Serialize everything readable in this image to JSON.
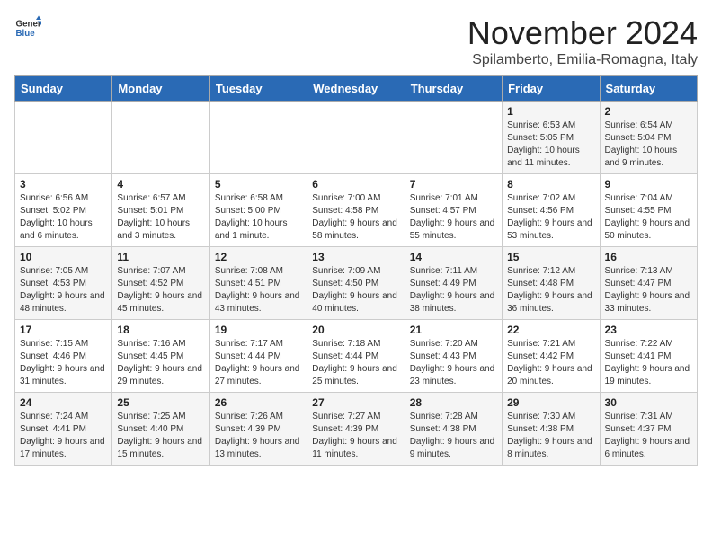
{
  "logo": {
    "text_general": "General",
    "text_blue": "Blue"
  },
  "header": {
    "month_year": "November 2024",
    "location": "Spilamberto, Emilia-Romagna, Italy"
  },
  "days_of_week": [
    "Sunday",
    "Monday",
    "Tuesday",
    "Wednesday",
    "Thursday",
    "Friday",
    "Saturday"
  ],
  "weeks": [
    [
      {
        "day": "",
        "info": ""
      },
      {
        "day": "",
        "info": ""
      },
      {
        "day": "",
        "info": ""
      },
      {
        "day": "",
        "info": ""
      },
      {
        "day": "",
        "info": ""
      },
      {
        "day": "1",
        "info": "Sunrise: 6:53 AM\nSunset: 5:05 PM\nDaylight: 10 hours and 11 minutes."
      },
      {
        "day": "2",
        "info": "Sunrise: 6:54 AM\nSunset: 5:04 PM\nDaylight: 10 hours and 9 minutes."
      }
    ],
    [
      {
        "day": "3",
        "info": "Sunrise: 6:56 AM\nSunset: 5:02 PM\nDaylight: 10 hours and 6 minutes."
      },
      {
        "day": "4",
        "info": "Sunrise: 6:57 AM\nSunset: 5:01 PM\nDaylight: 10 hours and 3 minutes."
      },
      {
        "day": "5",
        "info": "Sunrise: 6:58 AM\nSunset: 5:00 PM\nDaylight: 10 hours and 1 minute."
      },
      {
        "day": "6",
        "info": "Sunrise: 7:00 AM\nSunset: 4:58 PM\nDaylight: 9 hours and 58 minutes."
      },
      {
        "day": "7",
        "info": "Sunrise: 7:01 AM\nSunset: 4:57 PM\nDaylight: 9 hours and 55 minutes."
      },
      {
        "day": "8",
        "info": "Sunrise: 7:02 AM\nSunset: 4:56 PM\nDaylight: 9 hours and 53 minutes."
      },
      {
        "day": "9",
        "info": "Sunrise: 7:04 AM\nSunset: 4:55 PM\nDaylight: 9 hours and 50 minutes."
      }
    ],
    [
      {
        "day": "10",
        "info": "Sunrise: 7:05 AM\nSunset: 4:53 PM\nDaylight: 9 hours and 48 minutes."
      },
      {
        "day": "11",
        "info": "Sunrise: 7:07 AM\nSunset: 4:52 PM\nDaylight: 9 hours and 45 minutes."
      },
      {
        "day": "12",
        "info": "Sunrise: 7:08 AM\nSunset: 4:51 PM\nDaylight: 9 hours and 43 minutes."
      },
      {
        "day": "13",
        "info": "Sunrise: 7:09 AM\nSunset: 4:50 PM\nDaylight: 9 hours and 40 minutes."
      },
      {
        "day": "14",
        "info": "Sunrise: 7:11 AM\nSunset: 4:49 PM\nDaylight: 9 hours and 38 minutes."
      },
      {
        "day": "15",
        "info": "Sunrise: 7:12 AM\nSunset: 4:48 PM\nDaylight: 9 hours and 36 minutes."
      },
      {
        "day": "16",
        "info": "Sunrise: 7:13 AM\nSunset: 4:47 PM\nDaylight: 9 hours and 33 minutes."
      }
    ],
    [
      {
        "day": "17",
        "info": "Sunrise: 7:15 AM\nSunset: 4:46 PM\nDaylight: 9 hours and 31 minutes."
      },
      {
        "day": "18",
        "info": "Sunrise: 7:16 AM\nSunset: 4:45 PM\nDaylight: 9 hours and 29 minutes."
      },
      {
        "day": "19",
        "info": "Sunrise: 7:17 AM\nSunset: 4:44 PM\nDaylight: 9 hours and 27 minutes."
      },
      {
        "day": "20",
        "info": "Sunrise: 7:18 AM\nSunset: 4:44 PM\nDaylight: 9 hours and 25 minutes."
      },
      {
        "day": "21",
        "info": "Sunrise: 7:20 AM\nSunset: 4:43 PM\nDaylight: 9 hours and 23 minutes."
      },
      {
        "day": "22",
        "info": "Sunrise: 7:21 AM\nSunset: 4:42 PM\nDaylight: 9 hours and 20 minutes."
      },
      {
        "day": "23",
        "info": "Sunrise: 7:22 AM\nSunset: 4:41 PM\nDaylight: 9 hours and 19 minutes."
      }
    ],
    [
      {
        "day": "24",
        "info": "Sunrise: 7:24 AM\nSunset: 4:41 PM\nDaylight: 9 hours and 17 minutes."
      },
      {
        "day": "25",
        "info": "Sunrise: 7:25 AM\nSunset: 4:40 PM\nDaylight: 9 hours and 15 minutes."
      },
      {
        "day": "26",
        "info": "Sunrise: 7:26 AM\nSunset: 4:39 PM\nDaylight: 9 hours and 13 minutes."
      },
      {
        "day": "27",
        "info": "Sunrise: 7:27 AM\nSunset: 4:39 PM\nDaylight: 9 hours and 11 minutes."
      },
      {
        "day": "28",
        "info": "Sunrise: 7:28 AM\nSunset: 4:38 PM\nDaylight: 9 hours and 9 minutes."
      },
      {
        "day": "29",
        "info": "Sunrise: 7:30 AM\nSunset: 4:38 PM\nDaylight: 9 hours and 8 minutes."
      },
      {
        "day": "30",
        "info": "Sunrise: 7:31 AM\nSunset: 4:37 PM\nDaylight: 9 hours and 6 minutes."
      }
    ]
  ]
}
